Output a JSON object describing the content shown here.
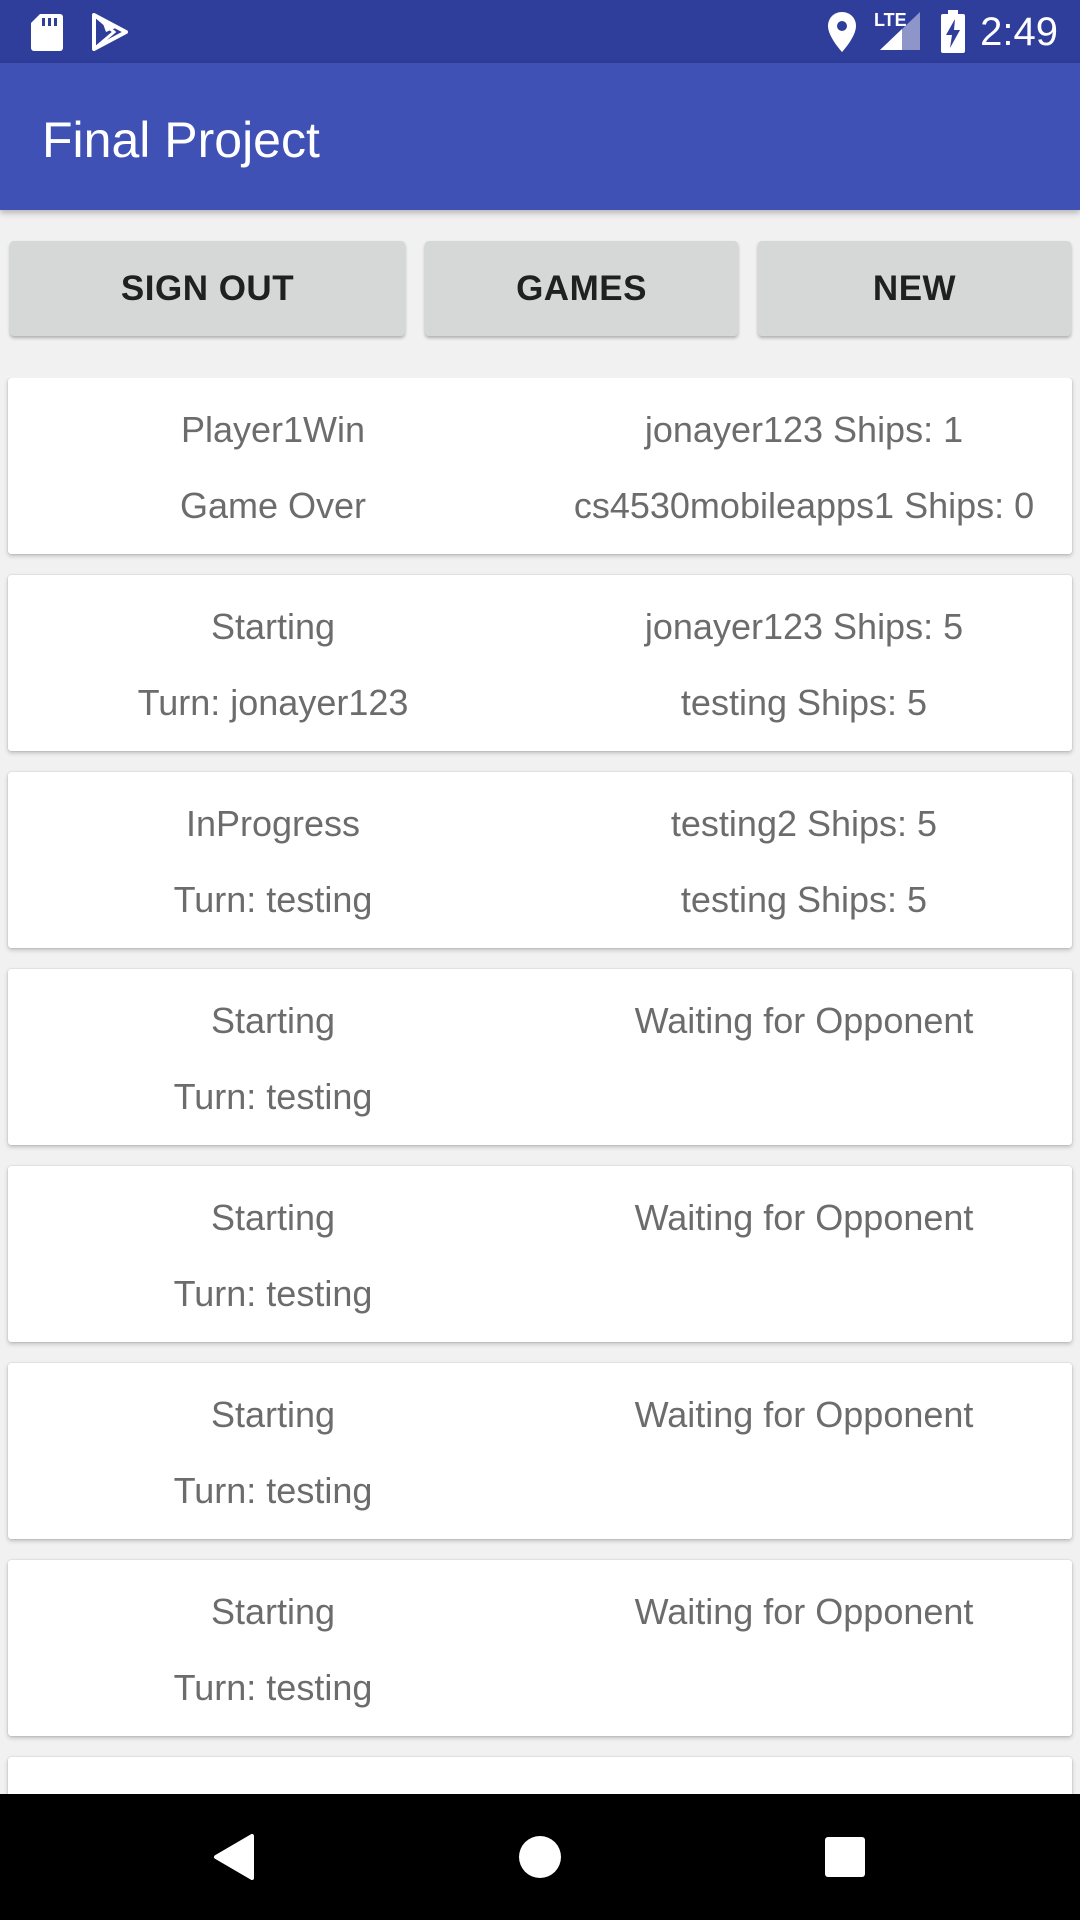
{
  "status_bar": {
    "time": "2:49",
    "network_label": "LTE",
    "icons": [
      "sd-card-icon",
      "play-store-icon",
      "location-icon",
      "signal-icon",
      "battery-charging-icon"
    ]
  },
  "app_bar": {
    "title": "Final Project"
  },
  "toolbar": {
    "sign_out_label": "SIGN OUT",
    "games_label": "GAMES",
    "new_label": "NEW"
  },
  "games": [
    {
      "status": "Player1Win",
      "detail": "Game Over",
      "player1": "jonayer123 Ships: 1",
      "player2": "cs4530mobileapps1 Ships: 0"
    },
    {
      "status": "Starting",
      "detail": "Turn: jonayer123",
      "player1": "jonayer123 Ships: 5",
      "player2": "testing Ships: 5"
    },
    {
      "status": "InProgress",
      "detail": "Turn: testing",
      "player1": "testing2 Ships: 5",
      "player2": "testing Ships: 5"
    },
    {
      "status": "Starting",
      "detail": "Turn: testing",
      "player1": "Waiting for Opponent",
      "player2": ""
    },
    {
      "status": "Starting",
      "detail": "Turn: testing",
      "player1": "Waiting for Opponent",
      "player2": ""
    },
    {
      "status": "Starting",
      "detail": "Turn: testing",
      "player1": "Waiting for Opponent",
      "player2": ""
    },
    {
      "status": "Starting",
      "detail": "Turn: testing",
      "player1": "Waiting for Opponent",
      "player2": ""
    },
    {
      "status": "",
      "detail": "",
      "player1": "",
      "player2": ""
    }
  ],
  "nav_bar": {
    "icons": [
      "back-icon",
      "home-icon",
      "recents-icon"
    ]
  },
  "colors": {
    "status_bar": "#2f3d9b",
    "app_bar": "#3f51b5",
    "button": "#d6d7d7",
    "background": "#f1f1f1",
    "card_text": "#6c6c6c"
  }
}
